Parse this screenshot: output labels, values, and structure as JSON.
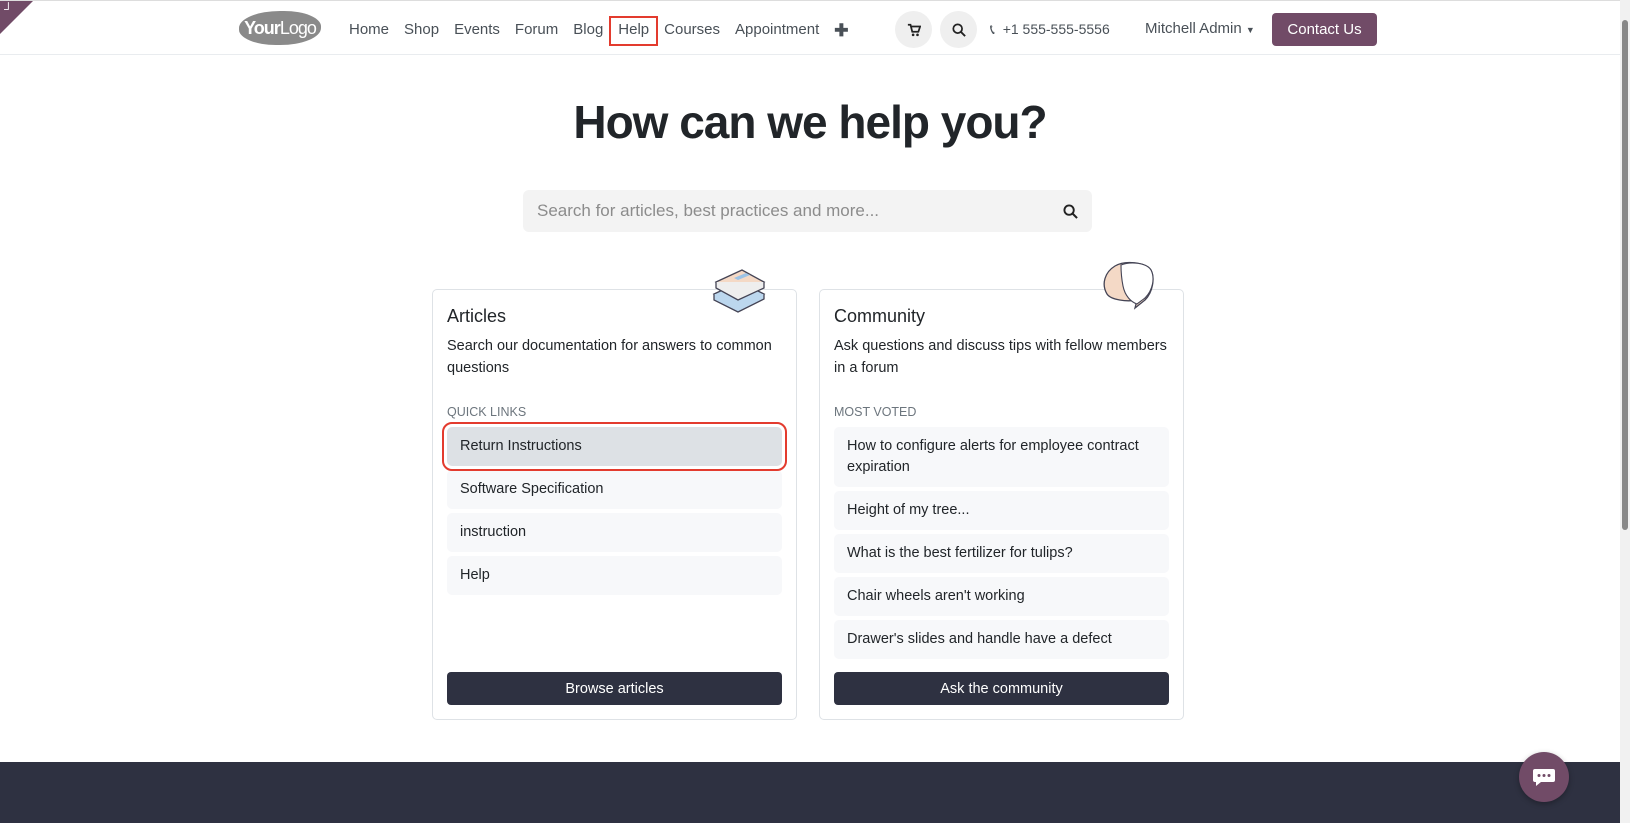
{
  "corner_icon": "edit-corner-icon",
  "nav": {
    "logo_a": "Your",
    "logo_b": "Logo",
    "items": [
      "Home",
      "Shop",
      "Events",
      "Forum",
      "Blog",
      "Help",
      "Courses",
      "Appointment"
    ],
    "active": "Help",
    "phone": "+1 555-555-5556",
    "user": "Mitchell Admin",
    "contact": "Contact Us"
  },
  "hero": {
    "title": "How can we help you?",
    "search_placeholder": "Search for articles, best practices and more..."
  },
  "articles": {
    "title": "Articles",
    "desc": "Search our documentation for answers to common questions",
    "label": "QUICK LINKS",
    "items": [
      "Return Instructions",
      "Software Specification",
      "instruction",
      "Help"
    ],
    "button": "Browse articles"
  },
  "community": {
    "title": "Community",
    "desc": "Ask questions and discuss tips with fellow members in a forum",
    "label": "MOST VOTED",
    "items": [
      "How to configure alerts for employee contract expiration",
      "Height of my tree...",
      "What is the best fertilizer for tulips?",
      "Chair wheels aren't working",
      "Drawer's slides and handle have a defect"
    ],
    "button": "Ask the community"
  },
  "colors": {
    "brand": "#714b67",
    "dark": "#2e3141",
    "highlight": "#e33b2e"
  }
}
